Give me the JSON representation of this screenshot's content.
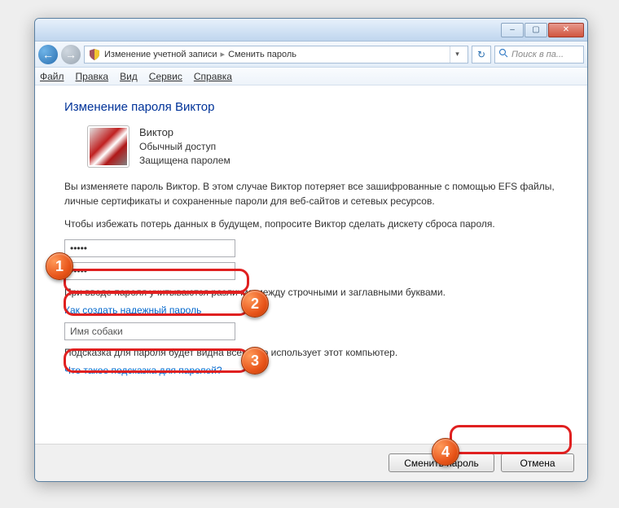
{
  "titlebar": {
    "minimize": "–",
    "maximize": "▢",
    "close": "✕"
  },
  "nav": {
    "back": "←",
    "forward": "→",
    "crumb1": "Изменение учетной записи",
    "crumb2": "Сменить пароль",
    "sep": "▸",
    "refresh": "↻",
    "search_placeholder": "Поиск в па..."
  },
  "menu": {
    "file": "Файл",
    "edit": "Правка",
    "view": "Вид",
    "tools": "Сервис",
    "help": "Справка"
  },
  "content": {
    "heading": "Изменение пароля Виктор",
    "user_name": "Виктор",
    "user_access": "Обычный доступ",
    "user_protected": "Защищена паролем",
    "warning_text": "Вы изменяете пароль Виктор. В этом случае Виктор потеряет все зашифрованные с помощью EFS файлы, личные сертификаты и сохраненные пароли для веб-сайтов и сетевых ресурсов.",
    "advice_text": "Чтобы избежать потерь данных в будущем, попросите Виктор сделать дискету сброса пароля.",
    "password1": "•••••",
    "password2": "•••••",
    "case_note": "При вводе пароля учитываются различия между строчными и заглавными буквами.",
    "link_strong": "Как создать надежный пароль",
    "hint_value": "Имя собаки",
    "hint_note": "Подсказка для пароля будет видна всем, кто использует этот компьютер.",
    "link_hint": "Что такое подсказка для паролей?"
  },
  "footer": {
    "change": "Сменить пароль",
    "cancel": "Отмена"
  },
  "callouts": {
    "n1": "1",
    "n2": "2",
    "n3": "3",
    "n4": "4"
  }
}
